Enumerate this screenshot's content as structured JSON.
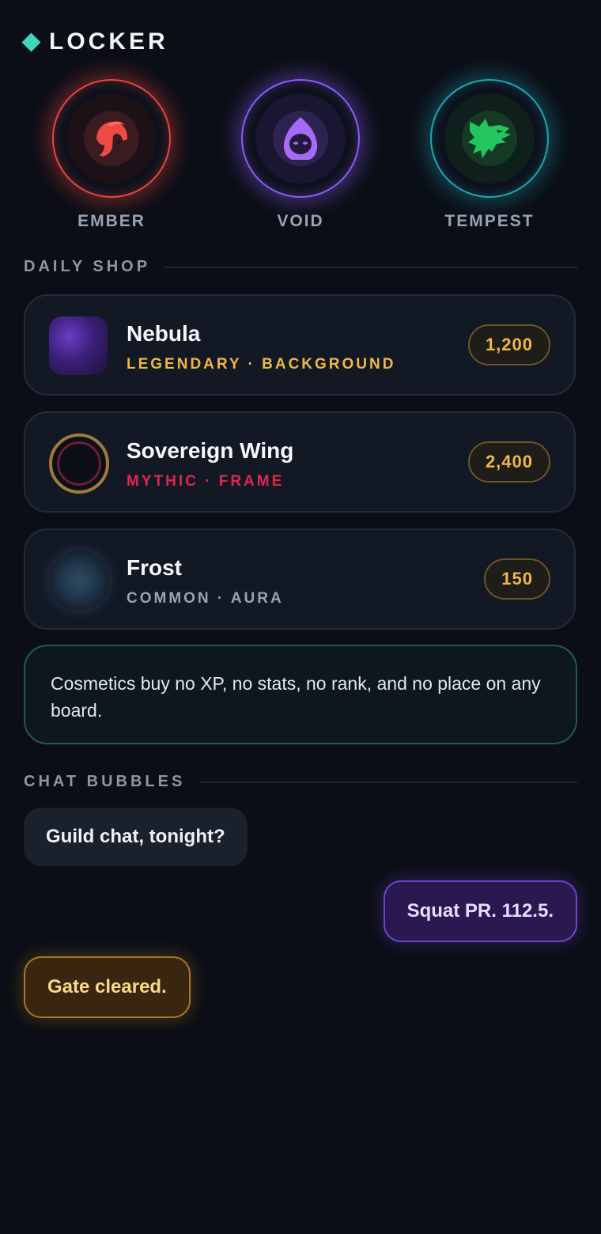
{
  "header": {
    "title": "LOCKER"
  },
  "emblems": [
    {
      "label": "EMBER",
      "icon": "spartan-helmet-icon",
      "color": "#e5453f"
    },
    {
      "label": "VOID",
      "icon": "hooded-figure-icon",
      "color": "#8b5cf6"
    },
    {
      "label": "TEMPEST",
      "icon": "wolf-head-icon",
      "color": "#22c55e"
    }
  ],
  "daily_shop": {
    "label": "DAILY SHOP",
    "items": [
      {
        "name": "Nebula",
        "meta": "LEGENDARY · BACKGROUND",
        "meta_color": "#f0b843",
        "price": "1,200"
      },
      {
        "name": "Sovereign Wing",
        "meta": "MYTHIC · FRAME",
        "meta_color": "#e0274f",
        "price": "2,400"
      },
      {
        "name": "Frost",
        "meta": "COMMON · AURA",
        "meta_color": "#9aa4b2",
        "price": "150"
      }
    ]
  },
  "note": {
    "text": "Cosmetics buy no XP, no stats, no rank, and no place on any board."
  },
  "chat_bubbles": {
    "label": "CHAT BUBBLES",
    "bubbles": [
      {
        "text": "Guild chat, tonight?"
      },
      {
        "text": "Squat PR. 112.5."
      },
      {
        "text": "Gate cleared."
      }
    ]
  }
}
